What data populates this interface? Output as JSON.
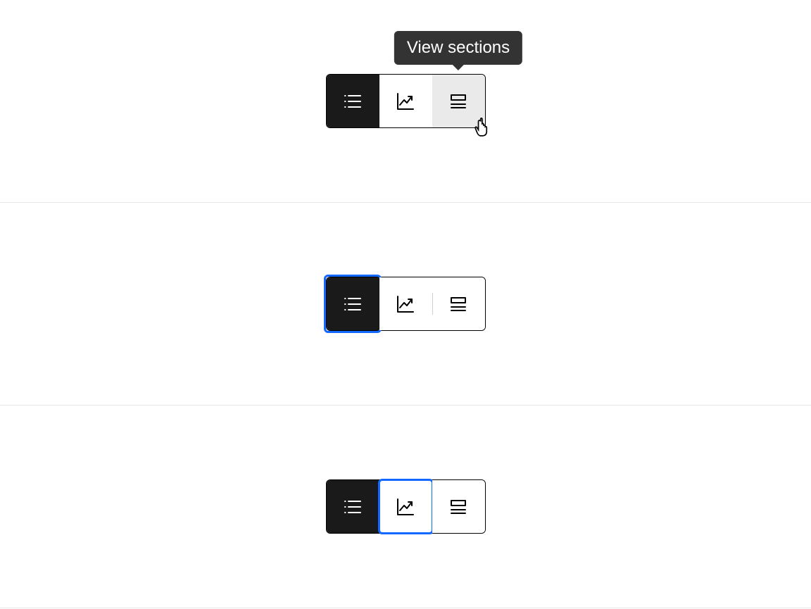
{
  "tooltip_text": "View sections",
  "segments": {
    "list": {
      "name": "list-icon"
    },
    "chart": {
      "name": "chart-icon"
    },
    "sections": {
      "name": "sections-icon"
    }
  },
  "examples": [
    {
      "id": "example-hover-tooltip",
      "selected": "list",
      "hovered": "sections",
      "focused": null,
      "show_tooltip": true,
      "show_cursor": true
    },
    {
      "id": "example-focus-selected",
      "selected": "list",
      "hovered": null,
      "focused": "list",
      "show_tooltip": false,
      "show_cursor": false
    },
    {
      "id": "example-focus-unselected",
      "selected": "list",
      "hovered": null,
      "focused": "chart",
      "show_tooltip": false,
      "show_cursor": false
    }
  ]
}
